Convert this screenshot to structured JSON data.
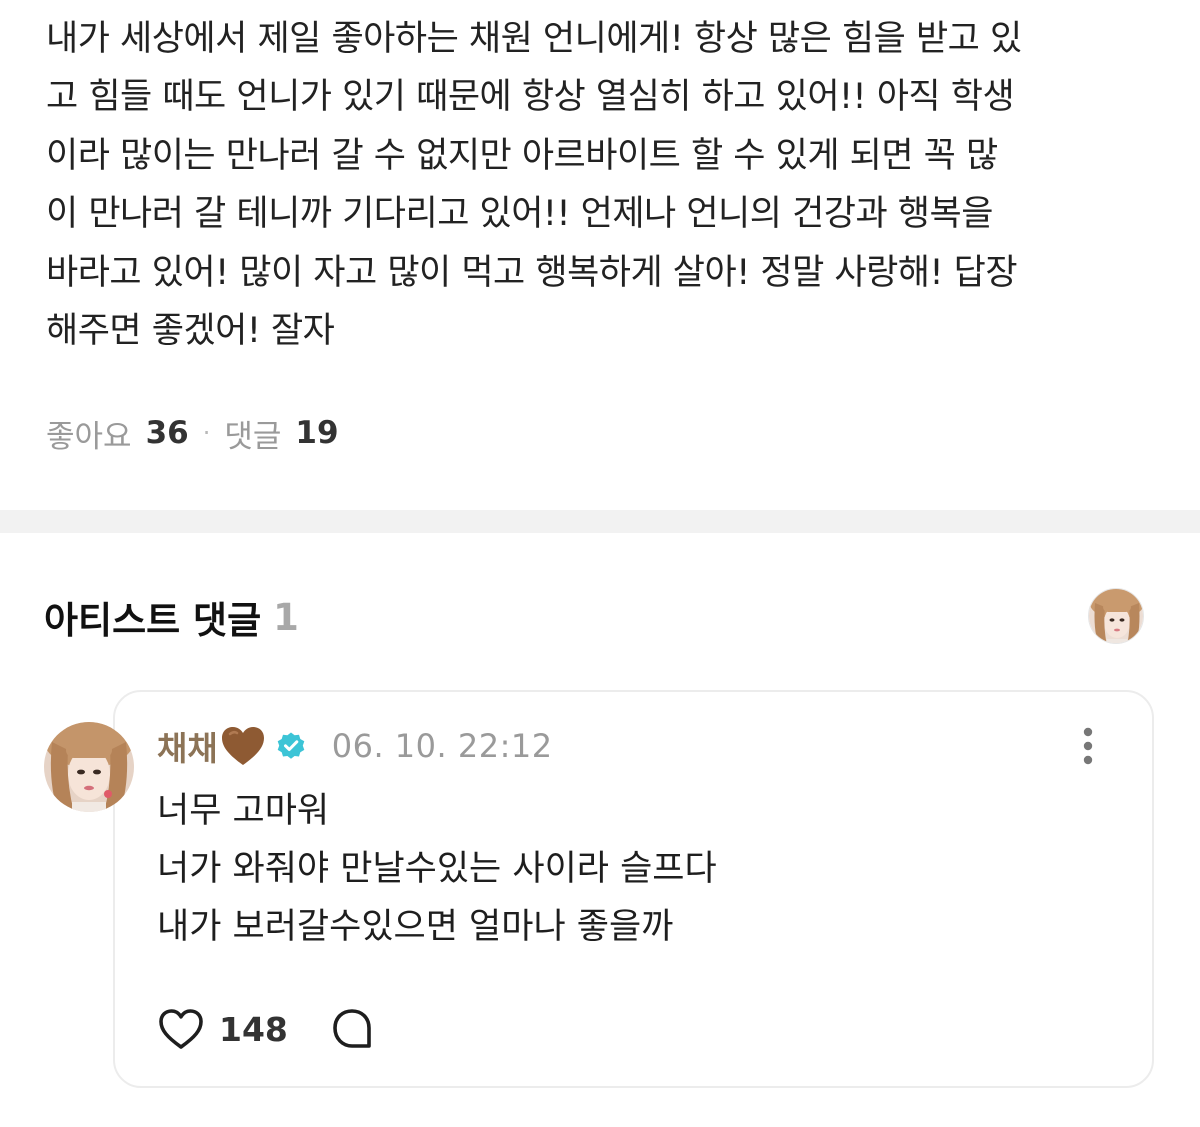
{
  "post": {
    "body": "내가 세상에서 제일 좋아하는 채원 언니에게! 항상 많은 힘을 받고 있\n고 힘들 때도 언니가 있기 때문에 항상 열심히 하고 있어!! 아직 학생\n이라 많이는 만나러 갈 수 없지만 아르바이트 할 수 있게 되면 꼭 많\n이 만나러 갈 테니까 기다리고 있어!! 언제나 언니의 건강과 행복을\n바라고 있어! 많이 자고 많이 먹고 행복하게 살아! 정말 사랑해! 답장\n해주면 좋겠어! 잘자",
    "likes_label": "좋아요",
    "likes_count": "36",
    "separator": "·",
    "comments_label": "댓글",
    "comments_count": "19"
  },
  "artist_comments": {
    "title": "아티스트 댓글",
    "count": "1"
  },
  "comment": {
    "author": "채채",
    "author_emoji": "brown-heart-icon",
    "verified_icon": "verified-badge-icon",
    "timestamp": "06. 10. 22:12",
    "lines": [
      "너무 고마워",
      "너가 와줘야 만날수있는 사이라 슬프다",
      "내가 보러갈수있으면 얼마나 좋을까"
    ],
    "like_count": "148",
    "author_color": "#8c7356",
    "verified_color": "#3cc4d6"
  },
  "colors": {
    "text_primary": "#222222",
    "text_muted": "#9a9a9a",
    "divider": "#f2f2f2",
    "card_border": "#ececec"
  }
}
